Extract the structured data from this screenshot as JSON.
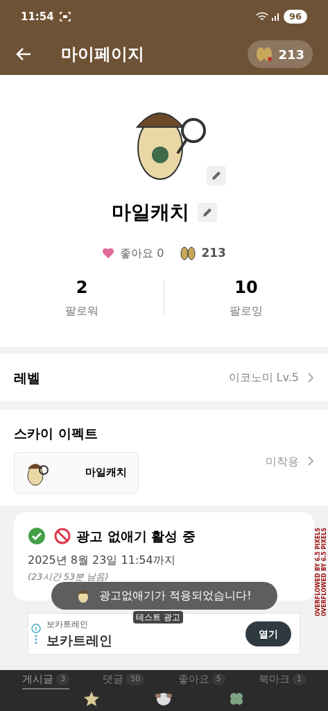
{
  "status_bar": {
    "time": "11:54",
    "battery": "96"
  },
  "app_bar": {
    "title": "마이페이지",
    "points": "213"
  },
  "profile": {
    "name": "마일캐치",
    "likes": "좋아요 0",
    "points": "213"
  },
  "stats": [
    {
      "value": "2",
      "label": "팔로워"
    },
    {
      "value": "10",
      "label": "팔로잉"
    }
  ],
  "level": {
    "label": "레벨",
    "value": "이코노미 Lv.5"
  },
  "sky_effect": {
    "title": "스카이 이펙트",
    "card_name": "마일캐치",
    "status": "미착용"
  },
  "ad_free": {
    "title": "광고 없애기 활성 중",
    "until": "2025년 8월 23일 11:54까지",
    "remaining": "(23시간 53분 남음)"
  },
  "toast": "광고없애기가 적용되었습니다!",
  "ad": {
    "label": "테스트 광고",
    "advertiser": "보카트레인",
    "headline": "보카트레인",
    "button": "열기"
  },
  "debug_overlays": [
    "OVERFLOWED BY 6.5 PIXELS",
    "OVERFLOWED BY 6.5 PIXELS"
  ],
  "tabs": [
    {
      "label": "게시글",
      "count": "3",
      "selected": true
    },
    {
      "label": "댓글",
      "count": "50",
      "selected": false
    },
    {
      "label": "좋아요",
      "count": "5",
      "selected": false
    },
    {
      "label": "북마크",
      "count": "1",
      "selected": false
    }
  ]
}
